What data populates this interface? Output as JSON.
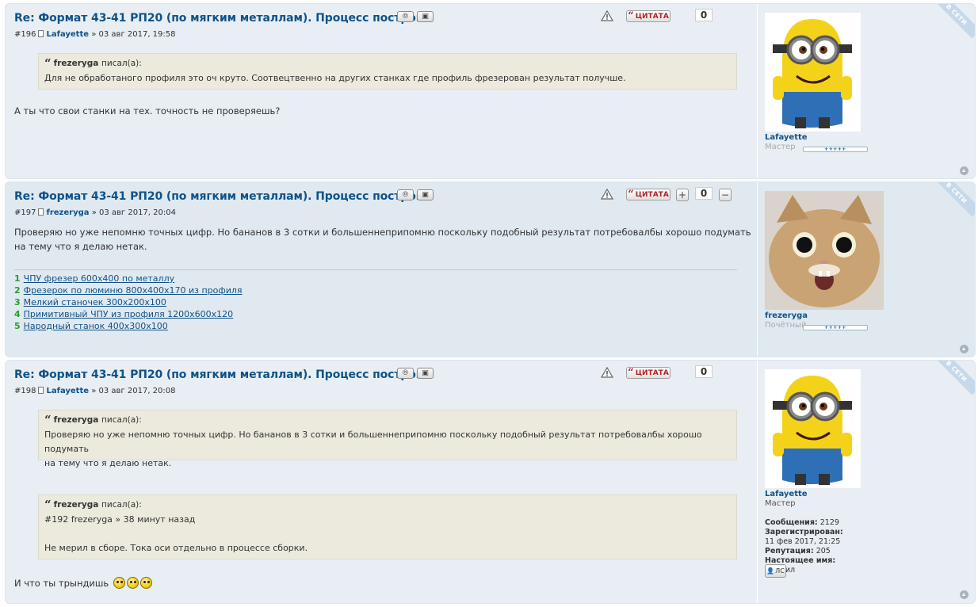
{
  "common": {
    "title": "Re: Формат 43-41 РП20 (по мягким металлам). Процесс постройк",
    "quote_label": "ЦИТАТА",
    "online_label": "В СЕТИ",
    "said_suffix": "писал(а):",
    "plus_label": "+",
    "minus_label": "−",
    "stars": "+++++"
  },
  "posts": [
    {
      "num": "#196",
      "author": "Lafayette",
      "date": "» 03 авг 2017, 19:58",
      "rep": "0",
      "quote_author": "frezeryga",
      "quote_text": "Для не обработаного профиля это оч круто. Соотвецтвенно на других станках где профиль фрезерован результат получше.",
      "body": "А ты что свои станки на тех. точность не проверяешь?",
      "profile_name": "Lafayette",
      "profile_rank": "Мастер"
    },
    {
      "num": "#197",
      "author": "frezeryga",
      "date": "» 03 авг 2017, 20:04",
      "rep": "0",
      "body_line1": "Проверяю но уже непомню точных цифр. Но бананов в 3 сотки и большеннеприпомню поскольку подобный результат потребовалбы хорошо подумать",
      "body_line2": "на тему что я делаю нетак.",
      "signature": [
        {
          "n": "1",
          "text": "ЧПУ фрезер 600х400 по металлу"
        },
        {
          "n": "2",
          "text": "Фрезерок по люминю 800х400х170 из профиля"
        },
        {
          "n": "3",
          "text": "Мелкий станочек 300х200х100"
        },
        {
          "n": "4",
          "text": "Примитивный ЧПУ из профиля 1200х600х120"
        },
        {
          "n": "5",
          "text": "Народный станок 400х300х100"
        }
      ],
      "profile_name": "frezeryga",
      "profile_rank": "Почётный"
    },
    {
      "num": "#198",
      "author": "Lafayette",
      "date": "» 03 авг 2017, 20:08",
      "rep": "0",
      "quote1_author": "frezeryga",
      "quote1_line1": "Проверяю но уже непомню точных цифр. Но бананов в 3 сотки и большеннеприпомню поскольку подобный результат потребовалбы хорошо подумать",
      "quote1_line2": "на тему что я делаю нетак.",
      "quote2_author": "frezeryga",
      "quote2_ref": "#192 frezeryga » 38 минут назад",
      "quote2_text": "Не мерил в сборе. Тока оси отдельно в процессе сборки.",
      "body": "И что ты трындишь",
      "profile_name": "Lafayette",
      "profile_rank": "Мастер",
      "stats": {
        "posts_label": "Сообщения:",
        "posts": "2129",
        "reg_label": "Зарегистрирован:",
        "reg": "11 фев 2017, 21:25",
        "rep_label": "Репутация:",
        "rep": "205",
        "name_label": "Настоящее имя:",
        "name": "Михаил"
      },
      "pm_label": "ЛС"
    }
  ]
}
